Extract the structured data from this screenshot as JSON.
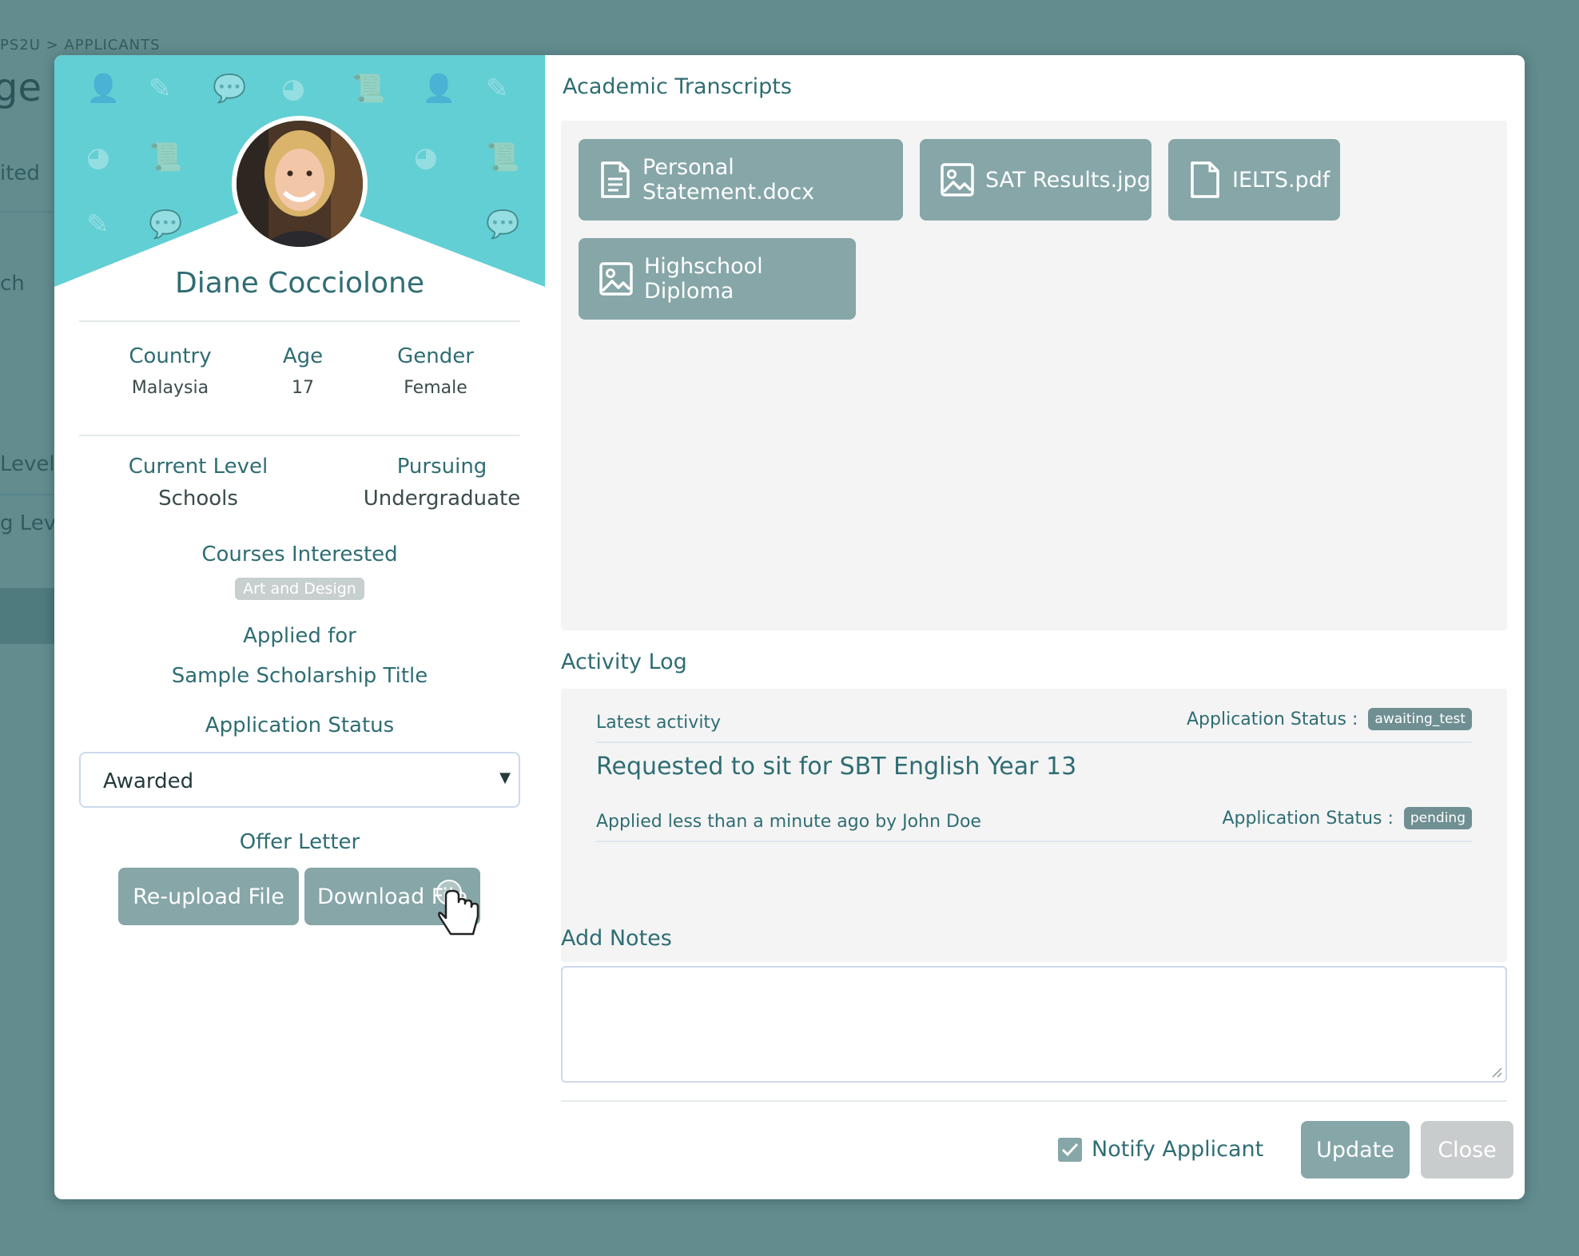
{
  "background": {
    "breadcrumb": "PS2U > APPLICANTS",
    "title_fragment": "ge S",
    "items": [
      "ited",
      "ch",
      "Level",
      "g Lev"
    ]
  },
  "profile": {
    "name": "Diane Cocciolone",
    "country_label": "Country",
    "country": "Malaysia",
    "age_label": "Age",
    "age": "17",
    "gender_label": "Gender",
    "gender": "Female",
    "current_level_label": "Current Level",
    "current_level": "Schools",
    "pursuing_label": "Pursuing",
    "pursuing": "Undergraduate",
    "courses_label": "Courses Interested",
    "course_tag": "Art and Design",
    "applied_label": "Applied for",
    "applied": "Sample Scholarship Title",
    "status_label": "Application Status",
    "status_value": "Awarded",
    "offer_label": "Offer Letter",
    "reupload_label": "Re-upload File",
    "download_label": "Download File"
  },
  "transcripts": {
    "title": "Academic Transcripts",
    "files": [
      {
        "label": "Personal Statement.docx",
        "icon": "document-icon"
      },
      {
        "label": "SAT Results.jpg",
        "icon": "image-icon"
      },
      {
        "label": "IELTS.pdf",
        "icon": "file-icon"
      },
      {
        "label": "Highschool Diploma",
        "icon": "image-icon"
      }
    ]
  },
  "activity": {
    "title": "Activity Log",
    "latest_label": "Latest activity",
    "status_label_1": "Application Status :",
    "status_badge_1": "awaiting_test",
    "message": "Requested to sit for SBT English Year 13",
    "applied_text": "Applied less than a minute ago by John Doe",
    "status_label_2": "Application Status :",
    "status_badge_2": "pending"
  },
  "notes": {
    "title": "Add Notes",
    "value": ""
  },
  "footer": {
    "notify_label": "Notify Applicant",
    "notify_checked": true,
    "update_label": "Update",
    "close_label": "Close"
  },
  "colors": {
    "backdrop": "#628c8e",
    "hero": "#62cfd4",
    "button": "#86a6a8",
    "button_disabled": "#c9cccc",
    "text_teal": "#2f6d73"
  }
}
